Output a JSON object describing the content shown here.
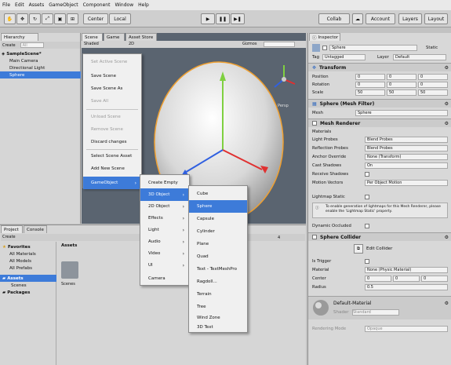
{
  "menubar": [
    "File",
    "Edit",
    "Assets",
    "GameObject",
    "Component",
    "Window",
    "Help"
  ],
  "toolbar": {
    "center": "Center",
    "local": "Local",
    "collab": "Collab",
    "account": "Account",
    "layers": "Layers",
    "layout": "Layout"
  },
  "hierarchy": {
    "tab": "Hierarchy",
    "create": "Create",
    "search_placeholder": "All",
    "scene": "SampleScene*",
    "items": [
      "Main Camera",
      "Directional Light",
      "Sphere"
    ]
  },
  "scene_tabs": [
    "Scene",
    "Game",
    "Asset Store"
  ],
  "scene_toolbar": {
    "shading": "Shaded",
    "mode": "2D",
    "gizmos": "Gizmos"
  },
  "scene_view": {
    "persp": "Persp"
  },
  "context_menu": {
    "items": [
      {
        "label": "Set Active Scene",
        "disabled": true
      },
      {
        "label": "Save Scene",
        "disabled": false
      },
      {
        "label": "Save Scene As",
        "disabled": false
      },
      {
        "label": "Save All",
        "disabled": true
      },
      {
        "label": "Unload Scene",
        "disabled": true
      },
      {
        "label": "Remove Scene",
        "disabled": true
      },
      {
        "label": "Discard changes",
        "disabled": false
      },
      {
        "label": "Select Scene Asset",
        "disabled": false
      },
      {
        "label": "Add New Scene",
        "disabled": false
      },
      {
        "label": "GameObject",
        "disabled": false
      }
    ]
  },
  "gameobject_menu": [
    "Create Empty",
    "3D Object",
    "2D Object",
    "Effects",
    "Light",
    "Audio",
    "Video",
    "UI",
    "Camera"
  ],
  "object3d_menu": [
    "Cube",
    "Sphere",
    "Capsule",
    "Cylinder",
    "Plane",
    "Quad",
    "Text - TextMeshPro",
    "Ragdoll...",
    "Terrain",
    "Tree",
    "Wind Zone",
    "3D Text"
  ],
  "project": {
    "tabs": [
      "Project",
      "Console"
    ],
    "create": "Create",
    "assets_header": "Assets",
    "favorites": "Favorites",
    "fav_items": [
      "All Materials",
      "All Models",
      "All Prefabs"
    ],
    "assets": "Assets",
    "asset_children": [
      "Scenes"
    ],
    "packages": "Packages",
    "grid_item": "Scenes",
    "count": "4"
  },
  "inspector": {
    "tab": "Inspector",
    "name": "Sphere",
    "static": "Static",
    "tag_label": "Tag",
    "tag": "Untagged",
    "layer_label": "Layer",
    "layer": "Default",
    "transform": {
      "title": "Transform",
      "rows": [
        {
          "label": "Position",
          "x": "0",
          "y": "0",
          "z": "0"
        },
        {
          "label": "Rotation",
          "x": "0",
          "y": "0",
          "z": "0"
        },
        {
          "label": "Scale",
          "x": "50",
          "y": "50",
          "z": "50"
        }
      ]
    },
    "mesh_filter": {
      "title": "Sphere (Mesh Filter)",
      "label": "Mesh",
      "value": "Sphere"
    },
    "mesh_renderer": {
      "title": "Mesh Renderer",
      "materials": "Materials",
      "rows": [
        {
          "label": "Light Probes",
          "value": "Blend Probes"
        },
        {
          "label": "Reflection Probes",
          "value": "Blend Probes"
        },
        {
          "label": "Anchor Override",
          "value": "None (Transform)"
        },
        {
          "label": "Cast Shadows",
          "value": "On"
        },
        {
          "label": "Receive Shadows",
          "value": ""
        },
        {
          "label": "Motion Vectors",
          "value": "Per Object Motion"
        }
      ],
      "lightmap_static": "Lightmap Static",
      "info": "To enable generation of lightmaps for this Mesh Renderer, please enable the 'Lightmap Static' property.",
      "dynamic_occluded": "Dynamic Occluded"
    },
    "sphere_collider": {
      "title": "Sphere Collider",
      "edit_collider": "Edit Collider",
      "rows": [
        {
          "label": "Is Trigger",
          "value": ""
        },
        {
          "label": "Material",
          "value": "None (Physic Material)"
        },
        {
          "label": "Center",
          "x": "0",
          "y": "0",
          "z": "0"
        },
        {
          "label": "Radius",
          "value": "0.5"
        }
      ]
    },
    "material": {
      "name": "Default-Material",
      "shader_label": "Shader",
      "shader": "Standard",
      "rendering_mode_label": "Rendering Mode",
      "rendering_mode": "Opaque"
    }
  },
  "colors": {
    "highlight": "#3d7bd9",
    "scene_bg": "#5a6470"
  }
}
